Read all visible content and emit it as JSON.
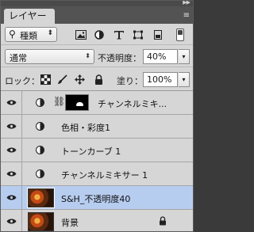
{
  "panel": {
    "tab_label": "レイヤー",
    "menu_icon": "panel-menu-icon",
    "collapse_icon": "double-chevron-icon"
  },
  "filter": {
    "kind_label": "種類",
    "icons": [
      "pixel-layer-filter-icon",
      "adjustment-layer-filter-icon",
      "type-layer-filter-icon",
      "shape-layer-filter-icon",
      "smart-object-filter-icon"
    ],
    "toggle_icon": "filter-toggle-icon"
  },
  "blend": {
    "mode": "通常",
    "opacity_label": "不透明度：",
    "opacity_value": "40%"
  },
  "lock": {
    "label": "ロック：",
    "icons": [
      "lock-transparent-pixels-icon",
      "lock-image-pixels-icon",
      "lock-position-icon",
      "lock-all-icon"
    ],
    "fill_label": "塗り：",
    "fill_value": "100%"
  },
  "layers": [
    {
      "name": "チャンネルミキ...",
      "kind": "adjustment-with-mask",
      "selected": false
    },
    {
      "name": "色相・彩度1",
      "kind": "adjustment",
      "selected": false
    },
    {
      "name": "トーンカーブ 1",
      "kind": "adjustment",
      "selected": false
    },
    {
      "name": "チャンネルミキサー 1",
      "kind": "adjustment",
      "selected": false
    },
    {
      "name": "S&H_不透明度40",
      "kind": "pixel",
      "selected": true
    },
    {
      "name": "背景",
      "kind": "background",
      "selected": false,
      "locked": true
    }
  ],
  "colors": {
    "panel_bg": "#d6d6d6",
    "selected_row": "#b7cdf0",
    "tab_strip": "#535353"
  }
}
